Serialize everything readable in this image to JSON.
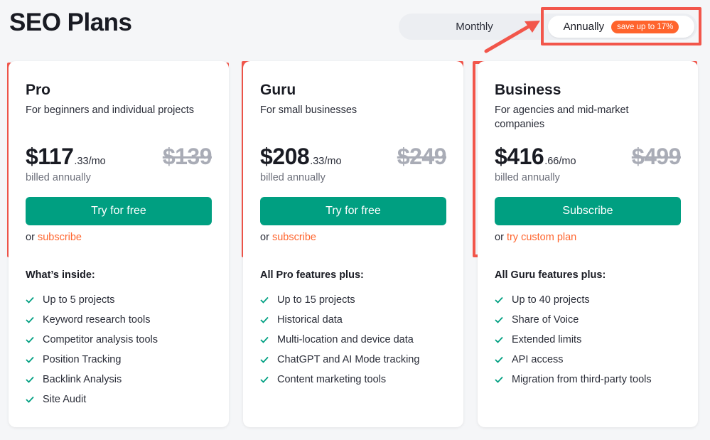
{
  "page": {
    "title": "SEO Plans"
  },
  "billing_toggle": {
    "monthly_label": "Monthly",
    "annually_label": "Annually",
    "save_badge": "save up to 17%",
    "selected": "Annually"
  },
  "colors": {
    "accent_green": "#009f81",
    "link_orange": "#ff642d",
    "annotation_red": "#f2564b"
  },
  "plans": [
    {
      "name": "Pro",
      "description": "For beginners and individual projects",
      "price_main": "$117",
      "price_cents": ".33/mo",
      "old_price": "$139",
      "billed": "billed annually",
      "cta_label": "Try for free",
      "alt_prefix": "or",
      "alt_link": "subscribe",
      "features_heading": "What’s inside:",
      "features": [
        "Up to 5 projects",
        "Keyword research tools",
        "Competitor analysis tools",
        "Position Tracking",
        "Backlink Analysis",
        "Site Audit"
      ]
    },
    {
      "name": "Guru",
      "description": "For small businesses",
      "price_main": "$208",
      "price_cents": ".33/mo",
      "old_price": "$249",
      "billed": "billed annually",
      "cta_label": "Try for free",
      "alt_prefix": "or",
      "alt_link": "subscribe",
      "features_heading": "All Pro features plus:",
      "features": [
        "Up to 15 projects",
        "Historical data",
        "Multi-location and device data",
        "ChatGPT and AI Mode tracking",
        "Content marketing tools"
      ]
    },
    {
      "name": "Business",
      "description": "For agencies and mid-market companies",
      "price_main": "$416",
      "price_cents": ".66/mo",
      "old_price": "$499",
      "billed": "billed annually",
      "cta_label": "Subscribe",
      "alt_prefix": "or",
      "alt_link": "try custom plan",
      "features_heading": "All Guru features plus:",
      "features": [
        "Up to 40 projects",
        "Share of Voice",
        "Extended limits",
        "API access",
        "Migration from third-party tools"
      ]
    }
  ]
}
